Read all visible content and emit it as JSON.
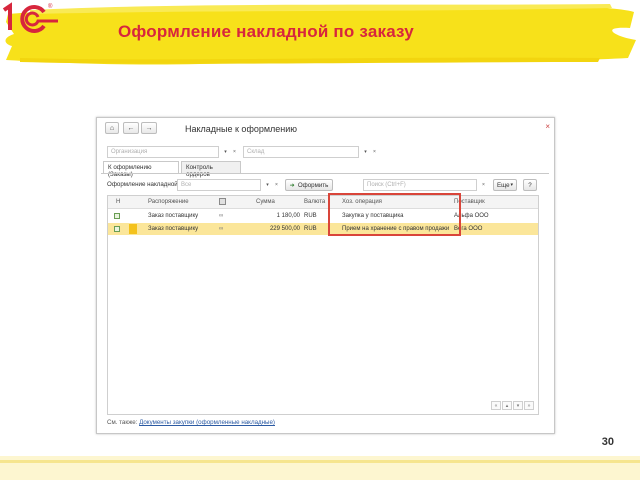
{
  "slide": {
    "title": "Оформление накладной по заказу",
    "page_number": "30",
    "brand_color": "#d7263d",
    "banner_color": "#f7e11a"
  },
  "window": {
    "title": "Накладные к оформлению",
    "nav_home_icon": "home-icon",
    "nav_back": "←",
    "nav_forward": "→",
    "close": "×",
    "org_placeholder": "Организация",
    "warehouse_placeholder": "Склад",
    "tabs": [
      "К оформлению (Заказы)",
      "Контроль ордеров"
    ],
    "invoice_label": "Оформление накладной:",
    "invoice_placeholder": "Все",
    "issue_button": "Оформить",
    "search_placeholder": "Поиск (Ctrl+F)",
    "more_button": "Еще",
    "help_button": "?"
  },
  "table": {
    "columns": [
      "Н",
      "Распоряжение",
      "",
      "Сумма",
      "Валюта",
      "Хоз. операция",
      "Поставщик"
    ],
    "rows": [
      {
        "order": "Заказ поставщику",
        "sum": "1 180,00",
        "currency": "RUB",
        "operation": "Закупка у поставщика",
        "supplier": "Альфа ООО",
        "selected": false
      },
      {
        "order": "Заказ поставщику",
        "sum": "229 500,00",
        "currency": "RUB",
        "operation": "Прием на хранение с правом продажи",
        "supplier": "Вега ООО",
        "selected": true
      }
    ]
  },
  "footer": {
    "see_also_label": "См. также:",
    "see_also_link": "Документы закупки (оформленные накладные)"
  }
}
